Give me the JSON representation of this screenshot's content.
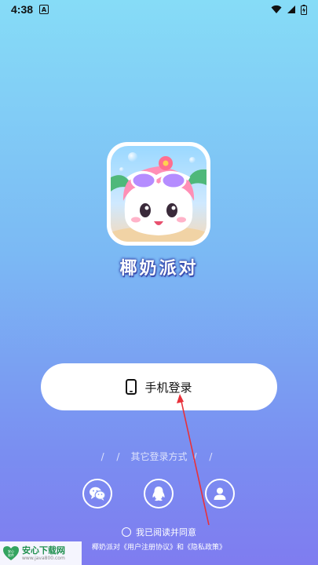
{
  "status_bar": {
    "time": "4:38",
    "notification_letter": "A"
  },
  "app": {
    "name": "椰奶派对"
  },
  "login": {
    "phone_label": "手机登录"
  },
  "other_login": {
    "title": "其它登录方式",
    "left_slashes": "/ /",
    "right_slashes": "/ /",
    "options": [
      "wechat-icon",
      "qq-icon",
      "user-icon"
    ]
  },
  "agreement": {
    "agree_label": "我已阅读并同意",
    "policy_text": "椰奶派对《用户注册协议》和《隐私政策》"
  },
  "watermark": {
    "badge": "安心 软件",
    "title": "安心下载网",
    "url": "www.java800.com"
  },
  "colors": {
    "arrow": "#e8313a",
    "brand_green": "#1f8f4e"
  }
}
